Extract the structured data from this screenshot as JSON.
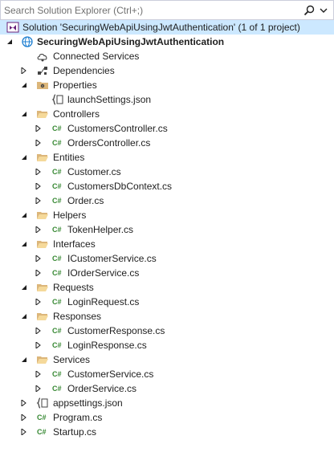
{
  "search": {
    "placeholder": "Search Solution Explorer (Ctrl+;)"
  },
  "solution": {
    "label": "Solution 'SecuringWebApiUsingJwtAuthentication' (1 of 1 project)"
  },
  "project": {
    "label": "SecuringWebApiUsingJwtAuthentication"
  },
  "items": {
    "connected_services": "Connected Services",
    "dependencies": "Dependencies",
    "properties": "Properties",
    "launch_settings": "launchSettings.json",
    "controllers": "Controllers",
    "customers_controller": "CustomersController.cs",
    "orders_controller": "OrdersController.cs",
    "entities": "Entities",
    "customer": "Customer.cs",
    "customers_db_context": "CustomersDbContext.cs",
    "order": "Order.cs",
    "helpers": "Helpers",
    "token_helper": "TokenHelper.cs",
    "interfaces": "Interfaces",
    "icustomer_service": "ICustomerService.cs",
    "iorder_service": "IOrderService.cs",
    "requests": "Requests",
    "login_request": "LoginRequest.cs",
    "responses": "Responses",
    "customer_response": "CustomerResponse.cs",
    "login_response": "LoginResponse.cs",
    "services": "Services",
    "customer_service": "CustomerService.cs",
    "order_service": "OrderService.cs",
    "appsettings": "appsettings.json",
    "program": "Program.cs",
    "startup": "Startup.cs"
  },
  "colors": {
    "selection": "#cce8ff",
    "folder": "#dcb67a",
    "csharp": "#368832",
    "solution": "#68217a",
    "project": "#1e7fd1"
  }
}
